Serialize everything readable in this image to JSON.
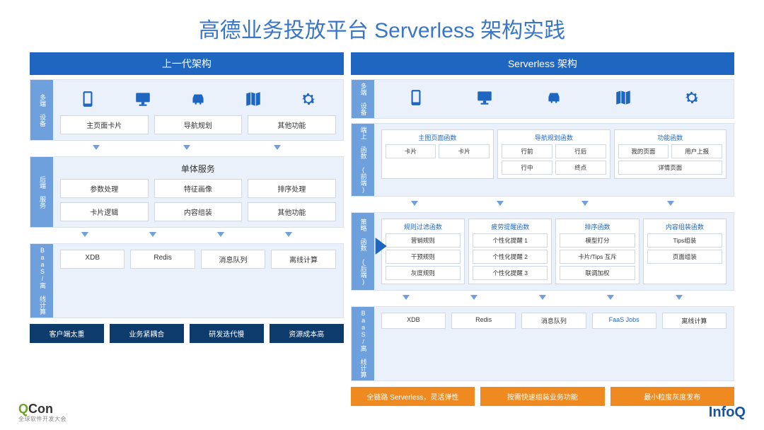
{
  "title": "高德业务投放平台 Serverless 架构实践",
  "left": {
    "header": "上一代架构",
    "sect1_label": "多端\n设备",
    "icons": [
      "phone",
      "desktop",
      "car",
      "map",
      "gear"
    ],
    "sect1_boxes": [
      "主页面卡片",
      "导航规划",
      "其他功能"
    ],
    "sect2_label": "后端\n服务",
    "sect2_title": "单体服务",
    "sect2_r1": [
      "参数处理",
      "特征画像",
      "排序处理"
    ],
    "sect2_r2": [
      "卡片逻辑",
      "内容组装",
      "其他功能"
    ],
    "sect3_label": "BaaS/离\n线计算",
    "sect3_boxes": [
      "XDB",
      "Redis",
      "消息队列",
      "离线计算"
    ],
    "bottom": [
      "客户端太重",
      "业务紧耦合",
      "研发迭代慢",
      "资源成本高"
    ]
  },
  "right": {
    "header": "Serverless 架构",
    "sect1_label": "多端\n设备",
    "icons": [
      "phone",
      "desktop",
      "car",
      "map",
      "gear"
    ],
    "sect2_label": "端上\n函数\n(前端)",
    "g1": {
      "title": "主图页面函数",
      "chips": [
        "卡片",
        "卡片"
      ]
    },
    "g2": {
      "title": "导航规划函数",
      "chips": [
        "行前",
        "行中",
        "行后",
        "终点"
      ]
    },
    "g3": {
      "title": "功能函数",
      "chips": [
        "我的页面",
        "用户上报",
        "详情页面"
      ]
    },
    "sect3_label": "策略\n函数\n(后端)",
    "h1": {
      "title": "规则过滤函数",
      "chips": [
        "营销规则",
        "干预规则",
        "灰度规则"
      ]
    },
    "h2": {
      "title": "疲劳提醒函数",
      "chips": [
        "个性化提醒 1",
        "个性化提醒 2",
        "个性化提醒 3"
      ]
    },
    "h3": {
      "title": "排序函数",
      "chips": [
        "模型打分",
        "卡片/Tips 互斥",
        "联调加权"
      ]
    },
    "h4": {
      "title": "内容组装函数",
      "chips": [
        "Tips组装",
        "页面组装"
      ]
    },
    "sect4_label": "BaaS/离\n线计算",
    "sect4_boxes": [
      "XDB",
      "Redis",
      "消息队列",
      "FaaS Jobs",
      "离线计算"
    ],
    "bottom": [
      "全链路 Serverless，灵活弹性",
      "按需快速组装业务功能",
      "最小粒度灰度发布"
    ]
  },
  "footer": {
    "qcon": "Q",
    "con": "Con",
    "qcon_sub": "全球软件开发大会",
    "infoq": "InfoQ"
  }
}
